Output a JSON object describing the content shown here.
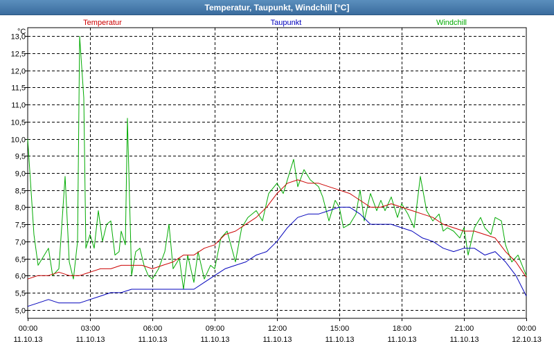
{
  "window": {
    "title": "Temperatur, Taupunkt, Windchill [°C]"
  },
  "chart_data": {
    "type": "line",
    "title": "Temperatur, Taupunkt, Windchill [°C]",
    "ylabel": "°C",
    "ylim": [
      4.75,
      13.25
    ],
    "y_ticks": [
      "13,0",
      "12,5",
      "12,0",
      "11,5",
      "11,0",
      "10,5",
      "10,0",
      "9,5",
      "9,0",
      "8,5",
      "8,0",
      "7,5",
      "7,0",
      "6,5",
      "6,0",
      "5,5",
      "5,0"
    ],
    "y_tick_values": [
      13.0,
      12.5,
      12.0,
      11.5,
      11.0,
      10.5,
      10.0,
      9.5,
      9.0,
      8.5,
      8.0,
      7.5,
      7.0,
      6.5,
      6.0,
      5.5,
      5.0
    ],
    "xlim_hours": [
      0,
      24
    ],
    "x_ticks": [
      {
        "hour": 0,
        "time": "00:00",
        "date": "11.10.13"
      },
      {
        "hour": 3,
        "time": "03:00",
        "date": "11.10.13"
      },
      {
        "hour": 6,
        "time": "06:00",
        "date": "11.10.13"
      },
      {
        "hour": 9,
        "time": "09:00",
        "date": "11.10.13"
      },
      {
        "hour": 12,
        "time": "12:00",
        "date": "11.10.13"
      },
      {
        "hour": 15,
        "time": "15:00",
        "date": "11.10.13"
      },
      {
        "hour": 18,
        "time": "18:00",
        "date": "11.10.13"
      },
      {
        "hour": 21,
        "time": "21:00",
        "date": "11.10.13"
      },
      {
        "hour": 24,
        "time": "00:00",
        "date": "12.10.13"
      }
    ],
    "grid": true,
    "legend_position": "top",
    "series": [
      {
        "name": "Temperatur",
        "color": "#cc0000",
        "points": [
          [
            0,
            5.9
          ],
          [
            0.5,
            6.0
          ],
          [
            1,
            6.0
          ],
          [
            1.5,
            6.1
          ],
          [
            2,
            6.0
          ],
          [
            2.5,
            6.0
          ],
          [
            3,
            6.1
          ],
          [
            3.5,
            6.2
          ],
          [
            4,
            6.2
          ],
          [
            4.5,
            6.3
          ],
          [
            5,
            6.3
          ],
          [
            5.5,
            6.3
          ],
          [
            6,
            6.2
          ],
          [
            6.5,
            6.3
          ],
          [
            7,
            6.4
          ],
          [
            7.5,
            6.6
          ],
          [
            8,
            6.6
          ],
          [
            8.5,
            6.8
          ],
          [
            9,
            6.9
          ],
          [
            9.5,
            7.2
          ],
          [
            10,
            7.3
          ],
          [
            10.5,
            7.5
          ],
          [
            11,
            7.7
          ],
          [
            11.5,
            8.0
          ],
          [
            12,
            8.4
          ],
          [
            12.5,
            8.7
          ],
          [
            13,
            8.8
          ],
          [
            13.5,
            8.7
          ],
          [
            14,
            8.7
          ],
          [
            14.5,
            8.6
          ],
          [
            15,
            8.5
          ],
          [
            15.5,
            8.4
          ],
          [
            16,
            8.2
          ],
          [
            16.5,
            8.0
          ],
          [
            17,
            8.0
          ],
          [
            17.5,
            8.1
          ],
          [
            18,
            8.0
          ],
          [
            18.5,
            7.9
          ],
          [
            19,
            7.8
          ],
          [
            19.5,
            7.7
          ],
          [
            20,
            7.5
          ],
          [
            20.5,
            7.4
          ],
          [
            21,
            7.3
          ],
          [
            21.5,
            7.3
          ],
          [
            22,
            7.2
          ],
          [
            22.5,
            7.1
          ],
          [
            23,
            6.7
          ],
          [
            23.5,
            6.4
          ],
          [
            24,
            5.95
          ]
        ]
      },
      {
        "name": "Taupunkt",
        "color": "#0000bb",
        "points": [
          [
            0,
            5.1
          ],
          [
            0.5,
            5.2
          ],
          [
            1,
            5.3
          ],
          [
            1.5,
            5.2
          ],
          [
            2,
            5.2
          ],
          [
            2.5,
            5.2
          ],
          [
            3,
            5.3
          ],
          [
            3.5,
            5.4
          ],
          [
            4,
            5.5
          ],
          [
            4.5,
            5.5
          ],
          [
            5,
            5.6
          ],
          [
            5.5,
            5.6
          ],
          [
            6,
            5.6
          ],
          [
            6.5,
            5.6
          ],
          [
            7,
            5.6
          ],
          [
            7.5,
            5.6
          ],
          [
            8,
            5.6
          ],
          [
            8.5,
            5.8
          ],
          [
            9,
            6.0
          ],
          [
            9.5,
            6.2
          ],
          [
            10,
            6.3
          ],
          [
            10.5,
            6.4
          ],
          [
            11,
            6.6
          ],
          [
            11.5,
            6.7
          ],
          [
            12,
            7.0
          ],
          [
            12.5,
            7.4
          ],
          [
            13,
            7.7
          ],
          [
            13.5,
            7.8
          ],
          [
            14,
            7.8
          ],
          [
            14.5,
            7.9
          ],
          [
            15,
            8.0
          ],
          [
            15.5,
            8.0
          ],
          [
            16,
            7.8
          ],
          [
            16.5,
            7.5
          ],
          [
            17,
            7.5
          ],
          [
            17.5,
            7.5
          ],
          [
            18,
            7.4
          ],
          [
            18.5,
            7.3
          ],
          [
            19,
            7.1
          ],
          [
            19.5,
            7.0
          ],
          [
            20,
            6.8
          ],
          [
            20.5,
            6.7
          ],
          [
            21,
            6.8
          ],
          [
            21.5,
            6.8
          ],
          [
            22,
            6.6
          ],
          [
            22.5,
            6.7
          ],
          [
            23,
            6.4
          ],
          [
            23.5,
            6.0
          ],
          [
            24,
            5.4
          ]
        ]
      },
      {
        "name": "Windchill",
        "color": "#00aa00",
        "points": [
          [
            0,
            10.0
          ],
          [
            0.3,
            7.2
          ],
          [
            0.5,
            6.3
          ],
          [
            0.8,
            6.6
          ],
          [
            1,
            6.8
          ],
          [
            1.2,
            6.0
          ],
          [
            1.5,
            6.2
          ],
          [
            1.8,
            8.9
          ],
          [
            2,
            6.4
          ],
          [
            2.2,
            5.9
          ],
          [
            2.4,
            7.0
          ],
          [
            2.5,
            13.0
          ],
          [
            2.7,
            11.2
          ],
          [
            2.8,
            6.8
          ],
          [
            3,
            7.2
          ],
          [
            3.2,
            6.8
          ],
          [
            3.4,
            7.9
          ],
          [
            3.6,
            7.0
          ],
          [
            3.8,
            7.5
          ],
          [
            4,
            7.6
          ],
          [
            4.2,
            6.6
          ],
          [
            4.4,
            6.7
          ],
          [
            4.5,
            7.3
          ],
          [
            4.7,
            6.9
          ],
          [
            4.8,
            10.6
          ],
          [
            5,
            6.0
          ],
          [
            5.2,
            6.7
          ],
          [
            5.4,
            6.8
          ],
          [
            5.6,
            6.3
          ],
          [
            5.8,
            6.0
          ],
          [
            6,
            5.9
          ],
          [
            6.3,
            6.2
          ],
          [
            6.6,
            6.7
          ],
          [
            6.8,
            7.5
          ],
          [
            7,
            6.2
          ],
          [
            7.3,
            6.5
          ],
          [
            7.5,
            5.6
          ],
          [
            7.7,
            6.6
          ],
          [
            8,
            5.8
          ],
          [
            8.2,
            6.7
          ],
          [
            8.5,
            5.9
          ],
          [
            8.8,
            6.3
          ],
          [
            9,
            6.2
          ],
          [
            9.3,
            7.1
          ],
          [
            9.6,
            7.3
          ],
          [
            10,
            6.4
          ],
          [
            10.3,
            7.4
          ],
          [
            10.6,
            7.7
          ],
          [
            11,
            7.9
          ],
          [
            11.3,
            7.6
          ],
          [
            11.6,
            8.4
          ],
          [
            12,
            8.7
          ],
          [
            12.3,
            8.4
          ],
          [
            12.6,
            9.0
          ],
          [
            12.8,
            9.4
          ],
          [
            13,
            8.6
          ],
          [
            13.3,
            9.1
          ],
          [
            13.6,
            8.8
          ],
          [
            14,
            8.6
          ],
          [
            14.2,
            8.3
          ],
          [
            14.5,
            7.6
          ],
          [
            14.8,
            8.2
          ],
          [
            15,
            8.0
          ],
          [
            15.2,
            7.4
          ],
          [
            15.5,
            7.5
          ],
          [
            15.8,
            7.8
          ],
          [
            16,
            8.5
          ],
          [
            16.2,
            7.6
          ],
          [
            16.5,
            8.4
          ],
          [
            16.8,
            7.9
          ],
          [
            17,
            8.2
          ],
          [
            17.2,
            7.9
          ],
          [
            17.5,
            8.3
          ],
          [
            17.8,
            7.7
          ],
          [
            18,
            8.1
          ],
          [
            18.3,
            7.8
          ],
          [
            18.6,
            7.4
          ],
          [
            18.9,
            8.9
          ],
          [
            19.2,
            7.9
          ],
          [
            19.5,
            7.6
          ],
          [
            19.8,
            7.8
          ],
          [
            20,
            7.3
          ],
          [
            20.2,
            7.4
          ],
          [
            20.5,
            7.3
          ],
          [
            20.8,
            7.1
          ],
          [
            21,
            7.4
          ],
          [
            21.2,
            6.6
          ],
          [
            21.5,
            7.4
          ],
          [
            21.8,
            7.7
          ],
          [
            22,
            7.4
          ],
          [
            22.3,
            7.2
          ],
          [
            22.5,
            7.7
          ],
          [
            22.8,
            7.6
          ],
          [
            23,
            6.9
          ],
          [
            23.3,
            6.4
          ],
          [
            23.6,
            6.6
          ],
          [
            24,
            6.0
          ]
        ]
      }
    ]
  }
}
